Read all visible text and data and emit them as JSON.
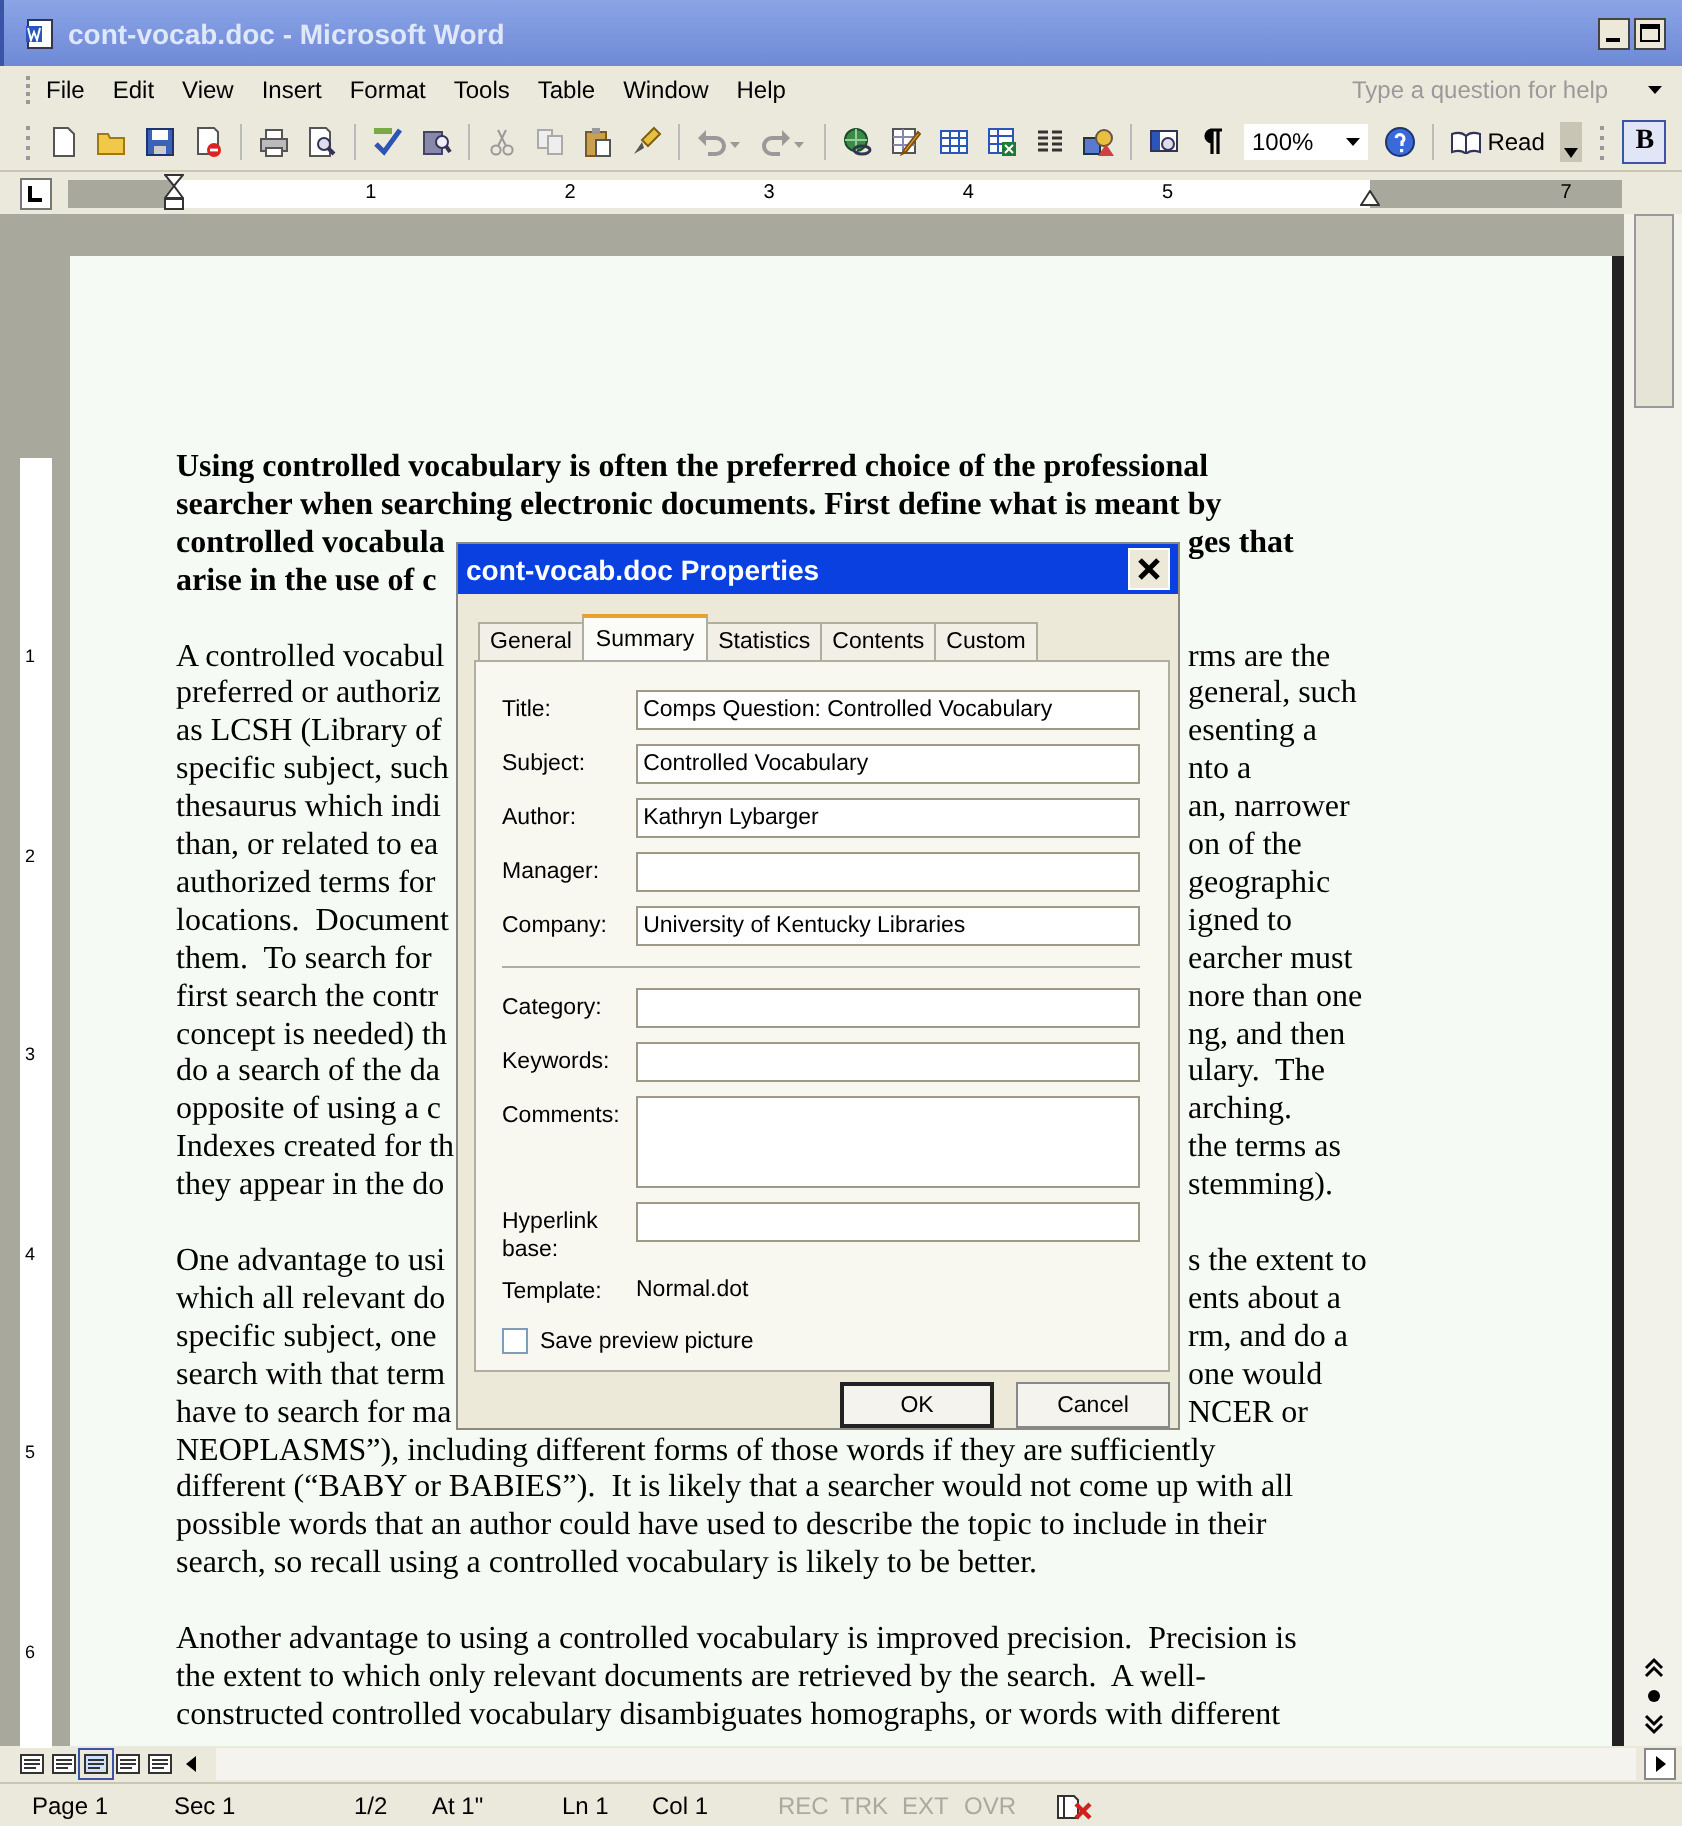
{
  "window": {
    "title": "cont-vocab.doc - Microsoft Word"
  },
  "menu": [
    "File",
    "Edit",
    "View",
    "Insert",
    "Format",
    "Tools",
    "Table",
    "Window",
    "Help"
  ],
  "help_box": {
    "placeholder": "Type a question for help"
  },
  "toolbar": {
    "zoom": "100%",
    "read": "Read",
    "bold": {
      "label": "B",
      "on": true
    }
  },
  "ruler": {
    "marks": [
      "1",
      "2",
      "3",
      "4",
      "5",
      "7"
    ]
  },
  "vertical_ruler": {
    "marks": [
      "1",
      "2",
      "3",
      "4",
      "5",
      "6"
    ]
  },
  "document": {
    "paragraphs": [
      {
        "kind": "heading",
        "lines": [
          {
            "text": "Using controlled vocabulary is often the preferred choice of the professional"
          },
          {
            "text": "searcher when searching electronic documents. First define what is meant by"
          },
          {
            "left": "controlled vocabula",
            "right": "ges that"
          },
          {
            "left": "arise in the use of c"
          }
        ]
      },
      {
        "kind": "body",
        "lines": [
          {
            "left": "A controlled vocabul",
            "right": "rms are the"
          },
          {
            "left": "preferred or authoriz",
            "right": "general, such"
          },
          {
            "left": "as LCSH (Library of",
            "right": "esenting a"
          },
          {
            "left": "specific subject, such",
            "right": "nto a"
          },
          {
            "left": "thesaurus which indi",
            "right": "an, narrower"
          },
          {
            "left": "than, or related to ea",
            "right": "on of the"
          },
          {
            "left": "authorized terms for",
            "right": "geographic"
          },
          {
            "left": "locations.  Document",
            "right": "igned to"
          },
          {
            "left": "them.  To search for",
            "right": "earcher must"
          },
          {
            "left": "first search the contr",
            "right": "nore than one"
          },
          {
            "left": "concept is needed) th",
            "right": "ng, and then"
          },
          {
            "left": "do a search of the da",
            "right": "ulary.  The"
          },
          {
            "left": "opposite of using a c",
            "right": "arching."
          },
          {
            "left": "Indexes created for th",
            "right": "the terms as"
          },
          {
            "left": "they appear in the do",
            "right": "stemming)."
          }
        ]
      },
      {
        "kind": "body",
        "lines": [
          {
            "left": "One advantage to usi",
            "right": "s the extent to"
          },
          {
            "left": "which all relevant do",
            "right": "ents about a"
          },
          {
            "left": "specific subject, one",
            "right": "rm, and do a"
          },
          {
            "left": "search with that term",
            "right": "one would"
          },
          {
            "left": "have to search for ma",
            "right": "NCER or"
          },
          {
            "text": "NEOPLASMS”), including different forms of those words if they are sufficiently"
          },
          {
            "text": "different (“BABY or BABIES”).  It is likely that a searcher would not come up with all"
          },
          {
            "text": "possible words that an author could have used to describe the topic to include in their"
          },
          {
            "text": "search, so recall using a controlled vocabulary is likely to be better."
          }
        ]
      },
      {
        "kind": "body",
        "lines": [
          {
            "text": "Another advantage to using a controlled vocabulary is improved precision.  Precision is"
          },
          {
            "text": "the extent to which only relevant documents are retrieved by the search.  A well-"
          },
          {
            "text": "constructed controlled vocabulary disambiguates homographs, or words with different"
          }
        ]
      }
    ]
  },
  "dialog": {
    "title": "cont-vocab.doc Properties",
    "tabs": [
      {
        "label": "General",
        "selected": false
      },
      {
        "label": "Summary",
        "selected": true
      },
      {
        "label": "Statistics",
        "selected": false
      },
      {
        "label": "Contents",
        "selected": false
      },
      {
        "label": "Custom",
        "selected": false
      }
    ],
    "fields": [
      {
        "kind": "text",
        "label": "Title:",
        "value": "Comps Question: Controlled Vocabulary"
      },
      {
        "kind": "text",
        "label": "Subject:",
        "value": "Controlled Vocabulary"
      },
      {
        "kind": "text",
        "label": "Author:",
        "value": "Kathryn Lybarger"
      },
      {
        "kind": "text",
        "label": "Manager:"
      },
      {
        "kind": "text",
        "label": "Company:",
        "value": "University of Kentucky Libraries"
      },
      {
        "kind": "divider"
      },
      {
        "kind": "text",
        "label": "Category:"
      },
      {
        "kind": "text",
        "label": "Keywords:"
      },
      {
        "kind": "multiline",
        "label": "Comments:"
      },
      {
        "kind": "text",
        "label": "Hyperlink base:"
      },
      {
        "kind": "static",
        "label": "Template:",
        "value": "Normal.dot"
      }
    ],
    "checkbox": {
      "label": "Save preview picture",
      "checked": false
    },
    "buttons": [
      {
        "label": "OK",
        "default": true
      },
      {
        "label": "Cancel",
        "default": false
      }
    ]
  },
  "status_bar": {
    "items": [
      {
        "text": "Page 1",
        "on": true
      },
      {
        "text": "Sec 1",
        "on": true
      },
      {
        "text": "1/2",
        "on": true
      },
      {
        "text": "At 1\"",
        "on": true
      },
      {
        "text": "Ln 1",
        "on": true
      },
      {
        "text": "Col 1",
        "on": true
      },
      {
        "text": "REC",
        "on": false
      },
      {
        "text": "TRK",
        "on": false
      },
      {
        "text": "EXT",
        "on": false
      },
      {
        "text": "OVR",
        "on": false
      }
    ]
  }
}
